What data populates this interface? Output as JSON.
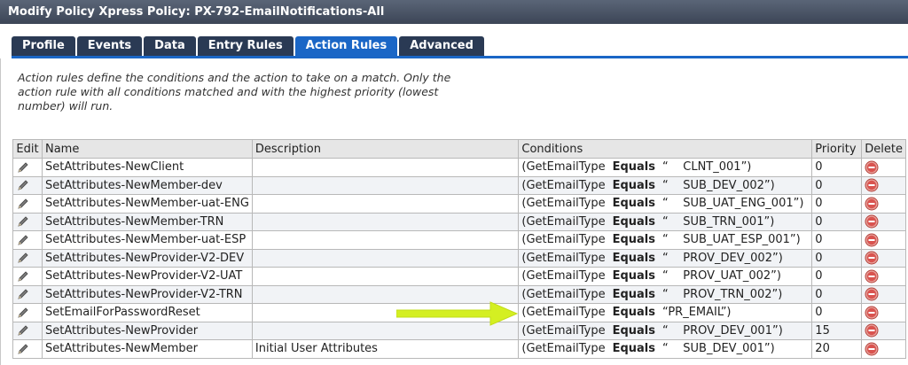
{
  "window": {
    "title": "Modify Policy Xpress Policy: PX-792-EmailNotifications-All"
  },
  "tabs": [
    {
      "label": "Profile",
      "active": false
    },
    {
      "label": "Events",
      "active": false
    },
    {
      "label": "Data",
      "active": false
    },
    {
      "label": "Entry Rules",
      "active": false
    },
    {
      "label": "Action Rules",
      "active": true
    },
    {
      "label": "Advanced",
      "active": false
    }
  ],
  "description": "Action rules define the conditions and the action to take on a match. Only the action rule with all conditions matched and with the highest priority (lowest number) will run.",
  "table": {
    "headers": {
      "edit": "Edit",
      "name": "Name",
      "description": "Description",
      "conditions": "Conditions",
      "priority": "Priority",
      "delete": "Delete"
    },
    "rows": [
      {
        "name": "SetAttributes-NewClient",
        "description": "",
        "cond_field": "(GetEmailType",
        "cond_op": "Equals",
        "cond_value": "“    CLNT_001”)",
        "priority": "0"
      },
      {
        "name": "SetAttributes-NewMember-dev",
        "description": "",
        "cond_field": "(GetEmailType",
        "cond_op": "Equals",
        "cond_value": "“    SUB_DEV_002”)",
        "priority": "0"
      },
      {
        "name": "SetAttributes-NewMember-uat-ENG",
        "description": "",
        "cond_field": "(GetEmailType",
        "cond_op": "Equals",
        "cond_value": "“    SUB_UAT_ENG_001”)",
        "priority": "0"
      },
      {
        "name": "SetAttributes-NewMember-TRN",
        "description": "",
        "cond_field": "(GetEmailType",
        "cond_op": "Equals",
        "cond_value": "“    SUB_TRN_001”)",
        "priority": "0"
      },
      {
        "name": "SetAttributes-NewMember-uat-ESP",
        "description": "",
        "cond_field": "(GetEmailType",
        "cond_op": "Equals",
        "cond_value": "“    SUB_UAT_ESP_001”)",
        "priority": "0"
      },
      {
        "name": "SetAttributes-NewProvider-V2-DEV",
        "description": "",
        "cond_field": "(GetEmailType",
        "cond_op": "Equals",
        "cond_value": "“    PROV_DEV_002”)",
        "priority": "0"
      },
      {
        "name": "SetAttributes-NewProvider-V2-UAT",
        "description": "",
        "cond_field": "(GetEmailType",
        "cond_op": "Equals",
        "cond_value": "“    PROV_UAT_002”)",
        "priority": "0"
      },
      {
        "name": "SetAttributes-NewProvider-V2-TRN",
        "description": "",
        "cond_field": "(GetEmailType",
        "cond_op": "Equals",
        "cond_value": "“    PROV_TRN_002”)",
        "priority": "0"
      },
      {
        "name": "SetEmailForPasswordReset",
        "description": "",
        "cond_field": "(GetEmailType",
        "cond_op": "Equals",
        "cond_value": "“PR_EMAIL”)",
        "priority": "0"
      },
      {
        "name": "SetAttributes-NewProvider",
        "description": "",
        "cond_field": "(GetEmailType",
        "cond_op": "Equals",
        "cond_value": "“    PROV_DEV_001”)",
        "priority": "15"
      },
      {
        "name": "SetAttributes-NewMember",
        "description": "Initial User Attributes",
        "cond_field": "(GetEmailType",
        "cond_op": "Equals",
        "cond_value": "“    SUB_DEV_001”)",
        "priority": "20"
      }
    ]
  },
  "icons": {
    "edit": "pencil-icon",
    "delete": "delete-minus-icon",
    "annotation": "arrow-right-icon"
  },
  "colors": {
    "titlebar": "#4a5466",
    "tab": "#2a3a54",
    "tab_active": "#1a66c6",
    "arrow": "#d4ef22",
    "delete": "#d9534f"
  }
}
